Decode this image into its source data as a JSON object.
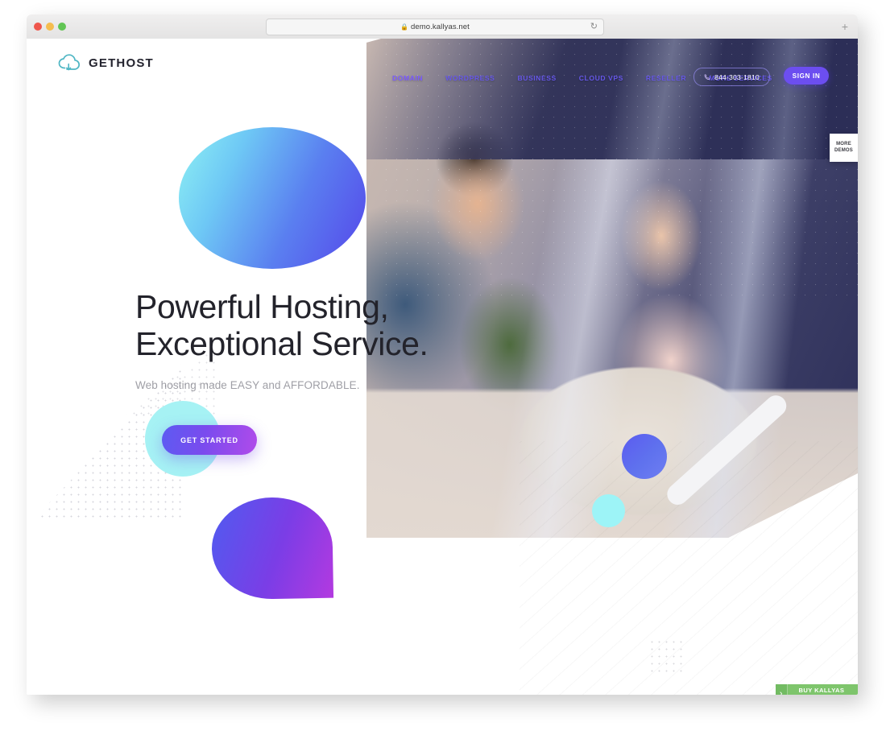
{
  "browser": {
    "url": "demo.kallyas.net",
    "lock_icon": "lock-icon",
    "reload_icon": "reload-icon",
    "newtab_label": "+"
  },
  "site": {
    "logo": {
      "icon": "cloud-icon",
      "text": "GETHOST",
      "color": "#4fb6c4"
    },
    "nav": [
      {
        "label": "DOMAIN",
        "active": true
      },
      {
        "label": "WORDPRESS",
        "active": false
      },
      {
        "label": "BUSINESS",
        "active": false
      },
      {
        "label": "CLOUD VPS",
        "active": false
      },
      {
        "label": "RESELLER",
        "active": false
      },
      {
        "label": "MORE SERVICES",
        "active": false
      }
    ],
    "phone": {
      "icon": "phone-icon",
      "number": "844-303-1810"
    },
    "signin_label": "SIGN IN",
    "hero": {
      "title": "Powerful Hosting,\nExceptional Service.",
      "subtitle": "Web hosting made EASY and AFFORDABLE.",
      "cta_label": "GET STARTED"
    },
    "more_demos": {
      "line1": "MORE",
      "line2": "DEMOS"
    },
    "buy_bar": {
      "arrow": "›",
      "label": "BUY KALLYAS THEME",
      "color": "#7ec56c"
    },
    "colors": {
      "accent_purple": "#6c4ef0",
      "accent_cyan": "#9df4f7",
      "nav_link": "#6657e8",
      "hero_text": "#23232b"
    }
  }
}
